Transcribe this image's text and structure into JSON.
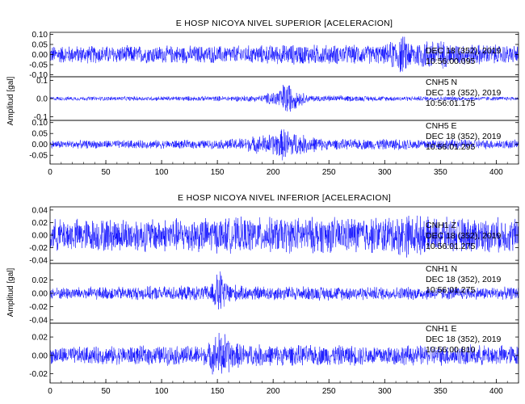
{
  "chart_data": [
    {
      "type": "line",
      "title": "E HOSP NICOYA NIVEL SUPERIOR [ACELERACION]",
      "ylabel": "Amplitud [gal]",
      "xlabel": "",
      "xlim": [
        0,
        420
      ],
      "x_ticks": [
        0,
        50,
        100,
        150,
        200,
        250,
        300,
        350,
        400
      ],
      "grid": false,
      "line_color": "#0000ff",
      "series": [
        {
          "name": "",
          "ylim": [
            -0.11,
            0.11
          ],
          "y_ticks": [
            "0.10",
            "0.05",
            "0.00",
            "-0.05",
            "-0.10"
          ],
          "annotation": [
            "DEC 18 (352), 2019",
            "10:56:00.095"
          ],
          "envelope": [
            [
              0,
              0.048
            ],
            [
              150,
              0.048
            ],
            [
              190,
              0.05
            ],
            [
              220,
              0.055
            ],
            [
              300,
              0.05
            ],
            [
              315,
              0.11
            ],
            [
              325,
              0.07
            ],
            [
              345,
              0.09
            ],
            [
              360,
              0.06
            ],
            [
              420,
              0.05
            ]
          ]
        },
        {
          "name": "CNH5 N",
          "ylim": [
            -0.12,
            0.12
          ],
          "y_ticks": [
            "0.1",
            "0.0",
            "-0.1"
          ],
          "annotation": [
            "CNH5 N",
            "DEC 18 (352), 2019",
            "10:56:01.175"
          ],
          "envelope": [
            [
              0,
              0.012
            ],
            [
              150,
              0.015
            ],
            [
              190,
              0.02
            ],
            [
              205,
              0.06
            ],
            [
              212,
              0.11
            ],
            [
              220,
              0.06
            ],
            [
              232,
              0.02
            ],
            [
              300,
              0.015
            ],
            [
              420,
              0.012
            ]
          ]
        },
        {
          "name": "CNH5 E",
          "ylim": [
            -0.09,
            0.11
          ],
          "y_ticks": [
            "0.10",
            "0.05",
            "0.00",
            "-0.05"
          ],
          "annotation": [
            "CNH5 E",
            "DEC 18 (352), 2019",
            "10:56:01.295"
          ],
          "envelope": [
            [
              0,
              0.02
            ],
            [
              150,
              0.022
            ],
            [
              175,
              0.035
            ],
            [
              200,
              0.055
            ],
            [
              210,
              0.085
            ],
            [
              225,
              0.05
            ],
            [
              250,
              0.025
            ],
            [
              320,
              0.028
            ],
            [
              420,
              0.022
            ]
          ]
        }
      ]
    },
    {
      "type": "line",
      "title": "E HOSP NICOYA NIVEL INFERIOR [ACELERACION]",
      "ylabel": "Amplitud [gal]",
      "xlabel": "",
      "xlim": [
        0,
        420
      ],
      "x_ticks": [
        0,
        50,
        100,
        150,
        200,
        250,
        300,
        350,
        400
      ],
      "grid": false,
      "line_color": "#0000ff",
      "series": [
        {
          "name": "CNH1 Z",
          "ylim": [
            -0.045,
            0.045
          ],
          "y_ticks": [
            "0.04",
            "0.02",
            "0.00",
            "-0.02",
            "-0.04"
          ],
          "annotation": [
            "CNH1 Z",
            "DEC 18 (352), 2019",
            "10:56:01.275"
          ],
          "envelope": [
            [
              0,
              0.028
            ],
            [
              150,
              0.03
            ],
            [
              300,
              0.032
            ],
            [
              320,
              0.038
            ],
            [
              340,
              0.03
            ],
            [
              420,
              0.03
            ]
          ]
        },
        {
          "name": "CNH1 N",
          "ylim": [
            -0.045,
            0.045
          ],
          "y_ticks": [
            "0.02",
            "0.00",
            "-0.02",
            "-0.04"
          ],
          "annotation": [
            "CNH1 N",
            "DEC 18 (352), 2019",
            "10:56:01.275"
          ],
          "envelope": [
            [
              0,
              0.01
            ],
            [
              140,
              0.012
            ],
            [
              148,
              0.025
            ],
            [
              152,
              0.042
            ],
            [
              158,
              0.02
            ],
            [
              170,
              0.012
            ],
            [
              420,
              0.01
            ]
          ]
        },
        {
          "name": "CNH1 E",
          "ylim": [
            -0.03,
            0.035
          ],
          "y_ticks": [
            "0.02",
            "0.00",
            "-0.02"
          ],
          "annotation": [
            "CNH1 E",
            "DEC 18 (352), 2019",
            "10:56:00.810"
          ],
          "envelope": [
            [
              0,
              0.01
            ],
            [
              140,
              0.012
            ],
            [
              150,
              0.028
            ],
            [
              155,
              0.03
            ],
            [
              165,
              0.015
            ],
            [
              200,
              0.012
            ],
            [
              420,
              0.012
            ]
          ]
        }
      ]
    }
  ]
}
